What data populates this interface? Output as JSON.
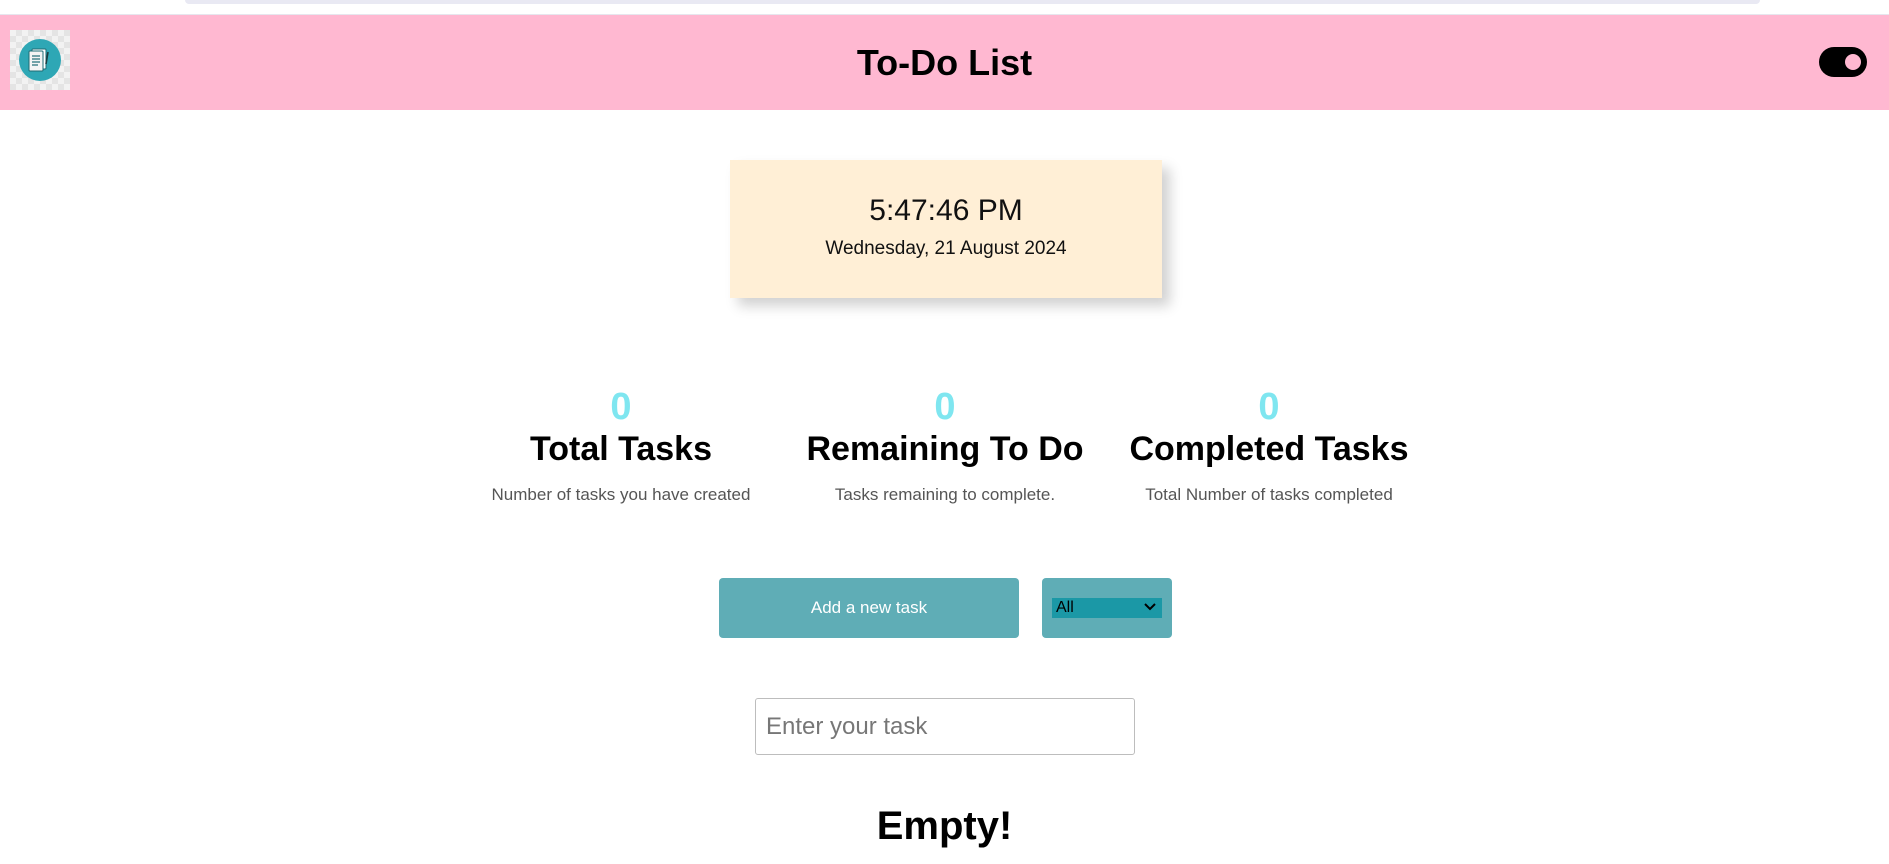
{
  "header": {
    "title": "To-Do List",
    "logo_icon": "notebook-icon",
    "theme_toggle": "on"
  },
  "clock": {
    "time": "5:47:46 PM",
    "date": "Wednesday, 21 August 2024"
  },
  "stats": [
    {
      "count": "0",
      "title": "Total Tasks",
      "description": "Number of tasks you have created"
    },
    {
      "count": "0",
      "title": "Remaining To Do",
      "description": "Tasks remaining to complete."
    },
    {
      "count": "0",
      "title": "Completed Tasks",
      "description": "Total Number of tasks completed"
    }
  ],
  "actions": {
    "add_label": "Add a new task",
    "filter_selected": "All"
  },
  "task_input": {
    "value": "",
    "placeholder": "Enter your task"
  },
  "task_list": {
    "empty_message": "Empty!"
  },
  "colors": {
    "header_bg": "#ffb8d1",
    "accent": "#5fadb6",
    "count": "#7fe6f0",
    "clock_bg": "#ffefd6"
  }
}
